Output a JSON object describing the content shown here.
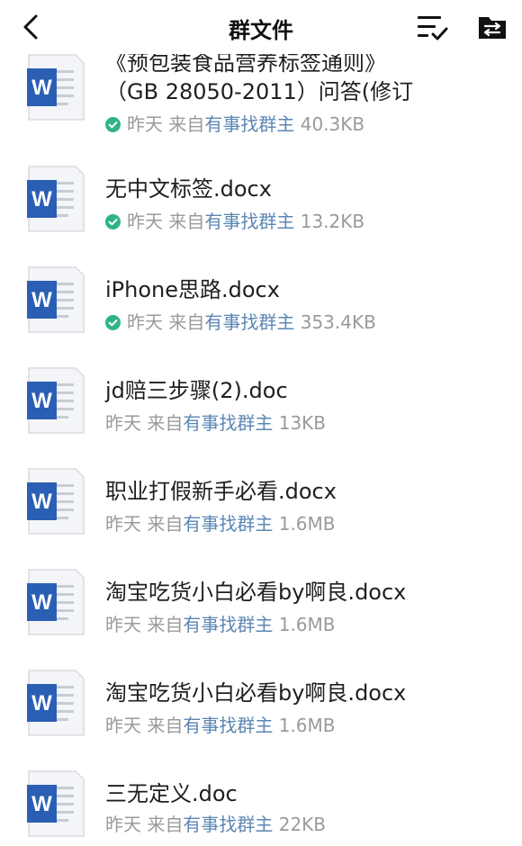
{
  "header": {
    "title": "群文件",
    "icons": [
      "back-chevron-icon",
      "sort-list-icon",
      "folder-icon"
    ]
  },
  "files": [
    {
      "name_line1": "《预包装食品营养标签通则》",
      "name_line2": "（GB 28050-2011）问答(修订",
      "time": "昨天",
      "source_prefix": "来自",
      "owner": "有事找群主",
      "size": "40.3KB",
      "downloaded": true,
      "icon": "word-doc-icon"
    },
    {
      "name_line1": "无中文标签.docx",
      "time": "昨天",
      "source_prefix": "来自",
      "owner": "有事找群主",
      "size": "13.2KB",
      "downloaded": true,
      "icon": "word-doc-icon"
    },
    {
      "name_line1": "iPhone思路.docx",
      "time": "昨天",
      "source_prefix": "来自",
      "owner": "有事找群主",
      "size": "353.4KB",
      "downloaded": true,
      "icon": "word-doc-icon"
    },
    {
      "name_line1": "jd赔三步骤(2).doc",
      "time": "昨天",
      "source_prefix": "来自",
      "owner": "有事找群主",
      "size": "13KB",
      "downloaded": false,
      "icon": "word-doc-icon"
    },
    {
      "name_line1": "职业打假新手必看.docx",
      "time": "昨天",
      "source_prefix": "来自",
      "owner": "有事找群主",
      "size": "1.6MB",
      "downloaded": false,
      "icon": "word-doc-icon"
    },
    {
      "name_line1": "淘宝吃货小白必看by啊良.docx",
      "time": "昨天",
      "source_prefix": "来自",
      "owner": "有事找群主",
      "size": "1.6MB",
      "downloaded": false,
      "icon": "word-doc-icon"
    },
    {
      "name_line1": "淘宝吃货小白必看by啊良.docx",
      "time": "昨天",
      "source_prefix": "来自",
      "owner": "有事找群主",
      "size": "1.6MB",
      "downloaded": false,
      "icon": "word-doc-icon"
    },
    {
      "name_line1": "三无定义.doc",
      "time": "昨天",
      "source_prefix": "来自",
      "owner": "有事找群主",
      "size": "22KB",
      "downloaded": false,
      "icon": "word-doc-icon"
    }
  ],
  "colors": {
    "word_blue": "#2b5fb4",
    "check_green": "#2fb583",
    "owner_link": "#5b87b3",
    "meta_gray": "#9a9a9a"
  }
}
